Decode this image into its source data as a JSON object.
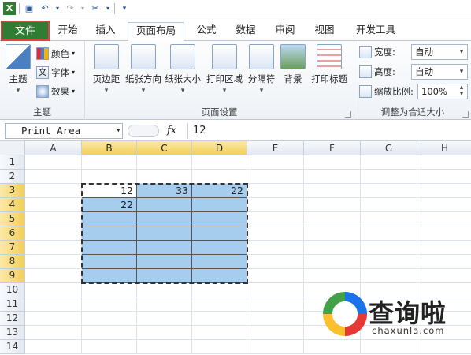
{
  "ribbon_tabs": [
    "文件",
    "开始",
    "插入",
    "页面布局",
    "公式",
    "数据",
    "审阅",
    "视图",
    "开发工具"
  ],
  "active_tab": "页面布局",
  "theme_group": {
    "label": "主题",
    "main": "主题",
    "colors": "颜色",
    "fonts": "字体",
    "effects": "效果"
  },
  "page_setup_group": {
    "label": "页面设置",
    "buttons": [
      "页边距",
      "纸张方向",
      "纸张大小",
      "打印区域",
      "分隔符",
      "背景",
      "打印标题"
    ]
  },
  "scale_group": {
    "label": "调整为合适大小",
    "width_label": "宽度:",
    "width_value": "自动",
    "height_label": "高度:",
    "height_value": "自动",
    "scale_label": "缩放比例:",
    "scale_value": "100%"
  },
  "formula_bar": {
    "name_box": "Print_Area",
    "fx": "fx",
    "value": "12"
  },
  "columns": [
    "A",
    "B",
    "C",
    "D",
    "E",
    "F",
    "G",
    "H"
  ],
  "selected_columns": [
    "B",
    "C",
    "D"
  ],
  "rows": [
    "1",
    "2",
    "3",
    "4",
    "5",
    "6",
    "7",
    "8",
    "9",
    "10",
    "11",
    "12",
    "13",
    "14"
  ],
  "selected_rows": [
    "3",
    "4",
    "5",
    "6",
    "7",
    "8",
    "9"
  ],
  "cells": {
    "B3": "12",
    "C3": "33",
    "D3": "22",
    "B4": "22"
  },
  "watermark": {
    "name": "查询啦",
    "url": "chaxunla.com"
  },
  "colors": {
    "file_tab": "#2f7d32",
    "selection": "#a6cdee",
    "header_sel": "#f3cf5a"
  }
}
